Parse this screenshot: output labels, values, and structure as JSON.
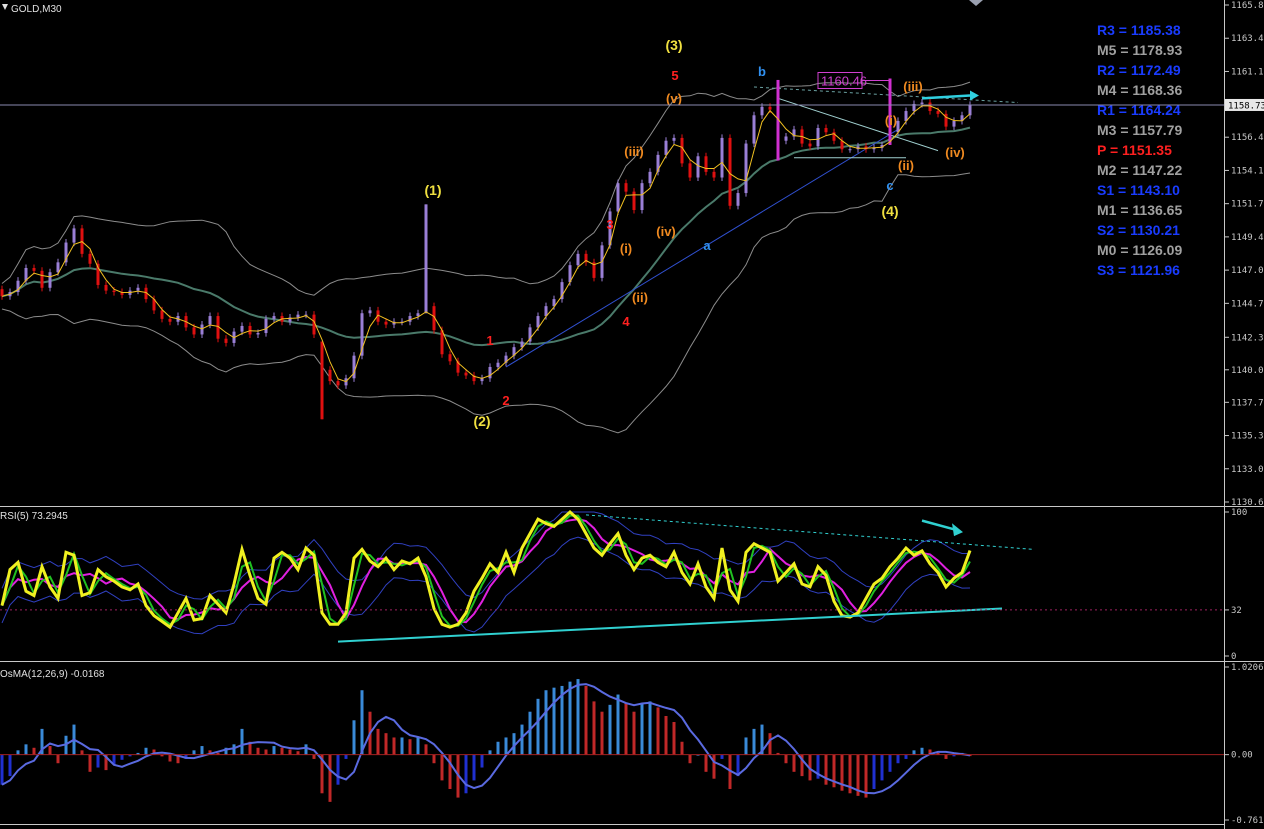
{
  "window": {
    "symbol_label": "GOLD,M30",
    "rsi_label": "RSI(5) 73.2945",
    "osma_label": "OsMA(12,26,9) -0.0168"
  },
  "chart_data": [
    {
      "id": "price",
      "type": "candlestick",
      "title": "GOLD,M30",
      "ylim": [
        1130.65,
        1165.8
      ],
      "yticks": [
        "1165.80",
        "1163.45",
        "1161.10",
        "1158.73",
        "1156.45",
        "1154.10",
        "1151.75",
        "1149.40",
        "1147.05",
        "1144.70",
        "1142.30",
        "1140.00",
        "1137.70",
        "1135.35",
        "1133.00",
        "1130.65"
      ],
      "current_price": "1158.73",
      "current_price_value": 1158.73,
      "price_tag": "1160.46",
      "price_tag_value": 1160.46,
      "colors": {
        "bull": "#9a7fd6",
        "bear": "#e01010",
        "spike": "#d030d0",
        "bands": "#8c8c8c",
        "middle": "#4a7a6a",
        "fast_ma": "#f0c020"
      },
      "closes": [
        1145.2,
        1145.5,
        1146.3,
        1147.2,
        1147.0,
        1145.8,
        1146.9,
        1147.6,
        1149.0,
        1150.0,
        1148.2,
        1147.5,
        1146.0,
        1145.6,
        1145.5,
        1145.3,
        1145.6,
        1145.8,
        1145.0,
        1144.2,
        1143.6,
        1143.4,
        1143.8,
        1143.0,
        1142.5,
        1143.2,
        1143.8,
        1142.2,
        1141.9,
        1142.7,
        1143.1,
        1142.5,
        1142.6,
        1143.6,
        1143.8,
        1143.4,
        1143.7,
        1143.9,
        1143.9,
        1142.5,
        1140.0,
        1139.2,
        1138.9,
        1139.4,
        1141.0,
        1144.0,
        1144.2,
        1143.4,
        1143.2,
        1143.4,
        1143.4,
        1143.8,
        1144.0,
        1144.5,
        1142.8,
        1141.1,
        1140.6,
        1139.8,
        1139.6,
        1139.2,
        1139.4,
        1140.2,
        1140.5,
        1141.0,
        1141.6,
        1142.0,
        1143.0,
        1143.8,
        1144.5,
        1145.0,
        1146.2,
        1147.4,
        1148.2,
        1147.6,
        1146.5,
        1148.8,
        1151.2,
        1153.2,
        1152.6,
        1151.3,
        1153.2,
        1154.0,
        1155.2,
        1156.2,
        1156.4,
        1154.6,
        1153.6,
        1155.1,
        1154.0,
        1153.6,
        1156.4,
        1151.6,
        1152.5,
        1156.0,
        1158.0,
        1158.6,
        1158.4,
        1156.2,
        1156.5,
        1157.0,
        1156.0,
        1155.8,
        1157.1,
        1156.8,
        1156.2,
        1155.6,
        1155.6,
        1155.8,
        1155.6,
        1155.7,
        1155.9,
        1156.8,
        1157.6,
        1158.3,
        1158.8,
        1158.9,
        1158.3,
        1158.1,
        1157.2,
        1157.6,
        1158.0,
        1158.73
      ],
      "annotations": [
        {
          "text": "(1)",
          "color": "#f0e040"
        },
        {
          "text": "(2)",
          "color": "#f0e040"
        },
        {
          "text": "(3)",
          "color": "#f0e040"
        },
        {
          "text": "(4)",
          "color": "#f0e040"
        },
        {
          "text": "1",
          "color": "#ff2020"
        },
        {
          "text": "2",
          "color": "#ff2020"
        },
        {
          "text": "3",
          "color": "#ff2020"
        },
        {
          "text": "4",
          "color": "#ff2020"
        },
        {
          "text": "5",
          "color": "#ff2020"
        },
        {
          "text": "(i)",
          "color": "#f08a20"
        },
        {
          "text": "(ii)",
          "color": "#f08a20"
        },
        {
          "text": "(iii)",
          "color": "#f08a20"
        },
        {
          "text": "(iv)",
          "color": "#f08a20"
        },
        {
          "text": "(v)",
          "color": "#f08a20"
        },
        {
          "text": "a",
          "color": "#3090f0"
        },
        {
          "text": "b",
          "color": "#3090f0"
        },
        {
          "text": "c",
          "color": "#3090f0"
        },
        {
          "text": "(i)",
          "color": "#f08a20"
        },
        {
          "text": "(ii)",
          "color": "#f08a20"
        },
        {
          "text": "(iii)",
          "color": "#f08a20"
        },
        {
          "text": "(iv)",
          "color": "#f08a20"
        }
      ],
      "pivots": [
        {
          "text": "R3 = 1185.38",
          "color": "#1a3cff"
        },
        {
          "text": "M5 = 1178.93",
          "color": "#a0a0a0"
        },
        {
          "text": "R2 = 1172.49",
          "color": "#1a3cff"
        },
        {
          "text": "M4 = 1168.36",
          "color": "#a0a0a0"
        },
        {
          "text": "R1 = 1164.24",
          "color": "#1a3cff"
        },
        {
          "text": "M3 = 1157.79",
          "color": "#a0a0a0"
        },
        {
          "text": "P   = 1151.35",
          "color": "#ff2020"
        },
        {
          "text": "M2 = 1147.22",
          "color": "#a0a0a0"
        },
        {
          "text": "S1 = 1143.10",
          "color": "#1a3cff"
        },
        {
          "text": "M1 = 1136.65",
          "color": "#a0a0a0"
        },
        {
          "text": "S2 = 1130.21",
          "color": "#1a3cff"
        },
        {
          "text": "M0 = 1126.09",
          "color": "#a0a0a0"
        },
        {
          "text": "S3 = 1121.96",
          "color": "#1a3cff"
        }
      ]
    },
    {
      "id": "rsi",
      "type": "line",
      "title": "RSI(5) 73.2945",
      "ylim": [
        0,
        100
      ],
      "yticks": [
        "100",
        "32",
        "0"
      ],
      "level": 32,
      "colors": {
        "rsi": "#f0f020",
        "signal1": "#20c020",
        "signal2": "#e020e0",
        "thin": "#3040c0",
        "trend": "#30d0d0"
      },
      "values": [
        35,
        60,
        65,
        45,
        42,
        62,
        48,
        40,
        72,
        70,
        42,
        44,
        60,
        55,
        52,
        48,
        46,
        50,
        35,
        28,
        24,
        20,
        30,
        40,
        25,
        26,
        42,
        36,
        30,
        50,
        74,
        56,
        40,
        36,
        68,
        72,
        68,
        60,
        75,
        70,
        30,
        22,
        22,
        30,
        68,
        74,
        66,
        62,
        68,
        60,
        66,
        64,
        68,
        55,
        33,
        22,
        20,
        22,
        30,
        45,
        54,
        64,
        58,
        72,
        58,
        75,
        85,
        95,
        92,
        90,
        95,
        100,
        95,
        85,
        75,
        70,
        78,
        85,
        70,
        60,
        68,
        70,
        65,
        62,
        72,
        58,
        50,
        64,
        48,
        40,
        75,
        46,
        38,
        72,
        78,
        75,
        72,
        52,
        58,
        64,
        50,
        48,
        62,
        56,
        38,
        28,
        27,
        30,
        40,
        50,
        54,
        62,
        68,
        75,
        70,
        73,
        64,
        58,
        48,
        54,
        58,
        73.29
      ]
    },
    {
      "id": "osma",
      "type": "bar",
      "title": "OsMA(12,26,9) -0.0168",
      "ylim": [
        -0.7611,
        1.0206
      ],
      "yticks": [
        "1.0206",
        "0.00",
        "-0.7611"
      ],
      "colors": {
        "up": "#3a8ad8",
        "down": "#c02828",
        "line": "#5a6ae0",
        "neg_fill": "#2030d0"
      },
      "values": [
        -0.35,
        -0.25,
        0.05,
        0.12,
        0.08,
        0.3,
        0.1,
        -0.1,
        0.22,
        0.35,
        0.05,
        -0.2,
        -0.15,
        -0.18,
        -0.12,
        -0.06,
        -0.02,
        0.02,
        0.08,
        0.06,
        -0.02,
        -0.08,
        -0.1,
        -0.05,
        0.05,
        0.1,
        0.05,
        0.02,
        0.08,
        0.12,
        0.3,
        0.15,
        0.08,
        0.06,
        0.1,
        0.08,
        0.06,
        0.04,
        0.12,
        -0.05,
        -0.45,
        -0.55,
        -0.35,
        -0.05,
        0.4,
        0.75,
        0.5,
        0.3,
        0.25,
        0.2,
        0.2,
        0.18,
        0.2,
        0.12,
        -0.1,
        -0.3,
        -0.4,
        -0.5,
        -0.45,
        -0.3,
        -0.15,
        0.05,
        0.15,
        0.2,
        0.25,
        0.35,
        0.5,
        0.65,
        0.75,
        0.78,
        0.8,
        0.85,
        0.88,
        0.8,
        0.62,
        0.5,
        0.58,
        0.7,
        0.6,
        0.5,
        0.6,
        0.62,
        0.55,
        0.45,
        0.38,
        0.15,
        -0.1,
        0.0,
        -0.2,
        -0.28,
        -0.05,
        -0.4,
        -0.25,
        0.2,
        0.3,
        0.35,
        0.25,
        0.02,
        -0.1,
        -0.2,
        -0.25,
        -0.3,
        -0.28,
        -0.35,
        -0.38,
        -0.42,
        -0.45,
        -0.48,
        -0.5,
        -0.4,
        -0.3,
        -0.2,
        -0.1,
        -0.05,
        0.05,
        0.08,
        0.06,
        0.02,
        -0.05,
        -0.02,
        0.02,
        -0.0168
      ]
    }
  ]
}
